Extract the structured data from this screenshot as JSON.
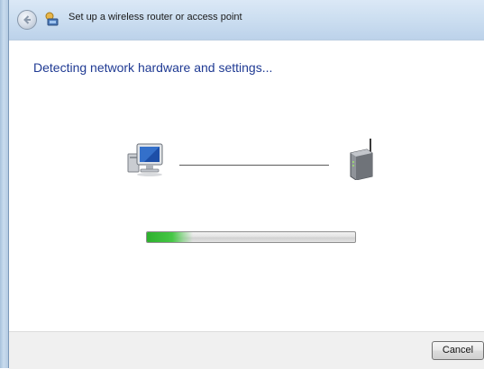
{
  "window": {
    "title": "Set up a wireless router or access point",
    "back_icon": "back-arrow-icon",
    "title_icon": "network-wizard-icon"
  },
  "main": {
    "heading": "Detecting network hardware and settings...",
    "left_icon": "computer-icon",
    "right_icon": "router-icon",
    "progress": {
      "fraction": 0.22
    }
  },
  "footer": {
    "cancel_label": "Cancel"
  },
  "colors": {
    "heading": "#1f3a93",
    "progress_fill": "#3cbf3c",
    "frame": "#c9dcee"
  }
}
